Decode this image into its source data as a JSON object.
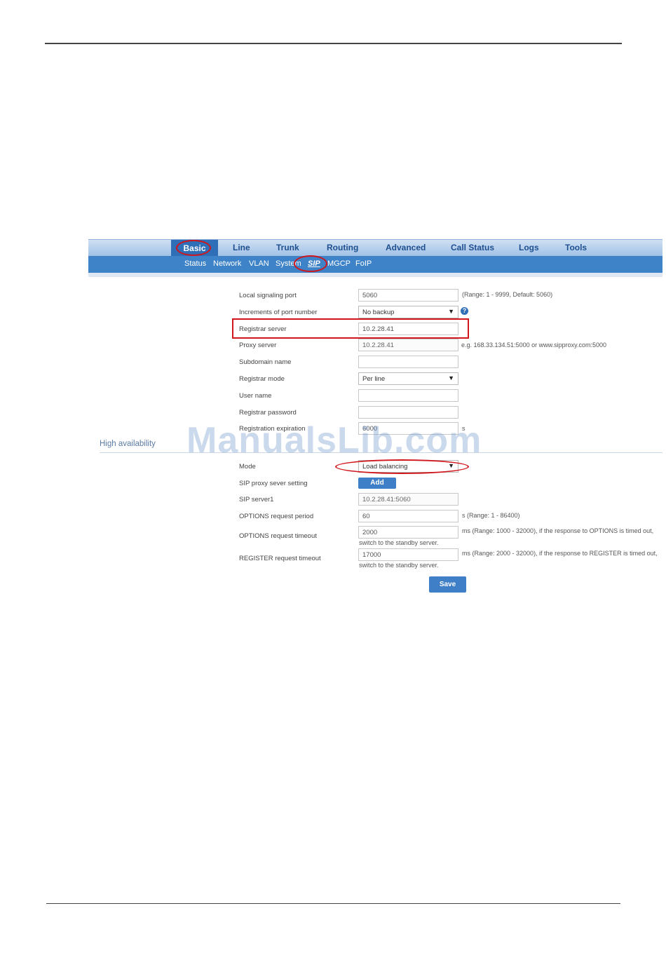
{
  "nav": {
    "items": [
      "Basic",
      "Line",
      "Trunk",
      "Routing",
      "Advanced",
      "Call Status",
      "Logs",
      "Tools"
    ],
    "active": "Basic"
  },
  "subnav": {
    "items": [
      "Status",
      "Network",
      "VLAN",
      "System",
      "SIP",
      "MGCP",
      "FoIP"
    ],
    "active": "SIP"
  },
  "form": {
    "local_port": {
      "label": "Local signaling port",
      "value": "5060",
      "hint": "(Range: 1 - 9999, Default: 5060)"
    },
    "port_increment": {
      "label": "Increments of port number",
      "value": "No backup",
      "help": "?"
    },
    "registrar_server": {
      "label": "Registrar server",
      "value": "10.2.28.41"
    },
    "proxy_server": {
      "label": "Proxy server",
      "value": "10.2.28.41",
      "hint": "e.g. 168.33.134.51:5000 or www.sipproxy.com:5000"
    },
    "subdomain": {
      "label": "Subdomain name",
      "value": ""
    },
    "registrar_mode": {
      "label": "Registrar mode",
      "value": "Per line"
    },
    "user_name": {
      "label": "User name",
      "value": ""
    },
    "registrar_password": {
      "label": "Registrar password",
      "value": ""
    },
    "registration_expiration": {
      "label": "Registration expiration",
      "value": "6000",
      "unit": "s"
    }
  },
  "high_availability": {
    "title": "High availability",
    "mode": {
      "label": "Mode",
      "value": "Load balancing"
    },
    "proxy_setting": {
      "label": "SIP proxy sever setting",
      "button": "Add"
    },
    "sip_server1": {
      "label": "SIP server1",
      "value": "10.2.28.41:5060"
    },
    "options_period": {
      "label": "OPTIONS request period",
      "value": "60",
      "hint": "s (Range: 1 - 86400)"
    },
    "options_timeout": {
      "label": "OPTIONS request timeout",
      "value": "2000",
      "hint": "ms (Range: 1000 - 32000), if the response to OPTIONS is timed out,",
      "hint2": "switch to the standby server."
    },
    "register_timeout": {
      "label": "REGISTER request timeout",
      "value": "17000",
      "hint": "ms (Range: 2000 - 32000), if the response to REGISTER is timed out,",
      "hint2": "switch to the standby server."
    }
  },
  "save_label": "Save",
  "watermark": "ManualsLib.com",
  "colors": {
    "accent": "#3f7fc8",
    "highlight": "#d0151b"
  }
}
